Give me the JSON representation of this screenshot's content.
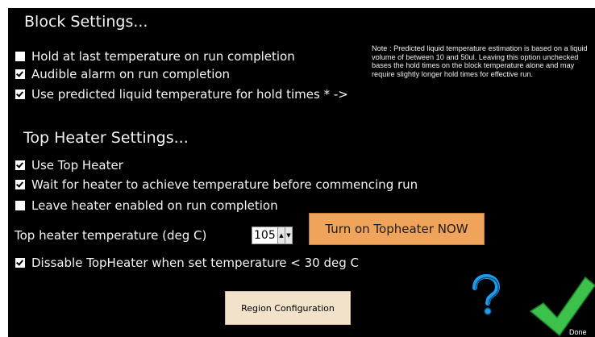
{
  "block_settings": {
    "title": "Block Settings...",
    "options": [
      {
        "label": "Hold at last temperature on run completion",
        "checked": false
      },
      {
        "label": "Audible alarm on run completion",
        "checked": true
      },
      {
        "label": "Use predicted liquid temperature for hold times * ->",
        "checked": true
      }
    ],
    "note": "Note : Predicted liquid temperature estimation is based on a liquid volume of between 10 and 50ul. Leaving this option unchecked bases the hold times on the block temperature alone and may require slightly longer hold times for effective run."
  },
  "top_heater_settings": {
    "title": "Top Heater Settings...",
    "options": [
      {
        "label": "Use Top Heater",
        "checked": true
      },
      {
        "label": "Wait for heater to achieve temperature before commencing run",
        "checked": true
      },
      {
        "label": "Leave heater enabled on run completion",
        "checked": false
      }
    ],
    "temperature_label": "Top heater temperature (deg C)",
    "temperature_value": "105",
    "turn_on_button": "Turn on Topheater NOW",
    "disable_option": {
      "label": "Dissable TopHeater when set temperature < 30 deg C",
      "checked": true
    }
  },
  "footer": {
    "region_button": "Region Configuration",
    "help_icon": "question-mark-icon",
    "done_label": "Done"
  },
  "colors": {
    "background": "#000000",
    "text": "#ffffff",
    "accent_orange": "#f0a35a",
    "help_blue": "#1f9bea",
    "done_green": "#3cc24a"
  }
}
